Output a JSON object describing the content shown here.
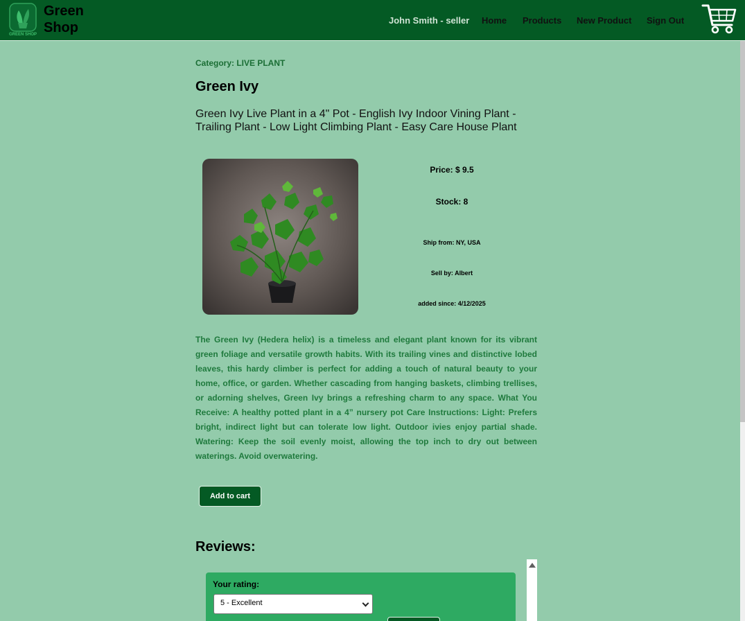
{
  "navbar": {
    "logo_title": "Green Shop",
    "logo_badge": "GREEN SHOP",
    "user": "John Smith - seller",
    "links": [
      "Home",
      "Products",
      "New Product",
      "Sign Out"
    ],
    "cart_icon": "shopping-cart-icon"
  },
  "product": {
    "category": "Category: LIVE PLANT",
    "name": "Green Ivy",
    "subtitle": "Green Ivy Live Plant in a 4\" Pot - English Ivy Indoor Vining Plant - Trailing Plant - Low Light Climbing Plant - Easy Care House Plant",
    "price": "Price: $ 9.5",
    "stock": "Stock: 8",
    "ship_from": "Ship from: NY, USA",
    "sell_by": "Sell by: Albert",
    "added": "added since: 4/12/2025",
    "description": "The Green Ivy (Hedera helix) is a timeless and elegant plant known for its vibrant green foliage and versatile growth habits. With its trailing vines and distinctive lobed leaves, this hardy climber is perfect for adding a touch of natural beauty to your home, office, or garden. Whether cascading from hanging baskets, climbing trellises, or adorning shelves, Green Ivy brings a refreshing charm to any space. What You Receive: A healthy potted plant in a 4” nursery pot Care Instructions: Light: Prefers bright, indirect light but can tolerate low light. Outdoor ivies enjoy partial shade. Watering: Keep the soil evenly moist, allowing the top inch to dry out between waterings. Avoid overwatering.",
    "add_to_cart": "Add to cart"
  },
  "reviews": {
    "title": "Reviews:",
    "rating_label": "Your rating:",
    "rating_value": "5 - Excellent"
  },
  "colors": {
    "navbar": "#045a24",
    "page_bg": "#93cbab",
    "description_text": "#1f7a3d",
    "rating_panel": "#2eaa62"
  }
}
